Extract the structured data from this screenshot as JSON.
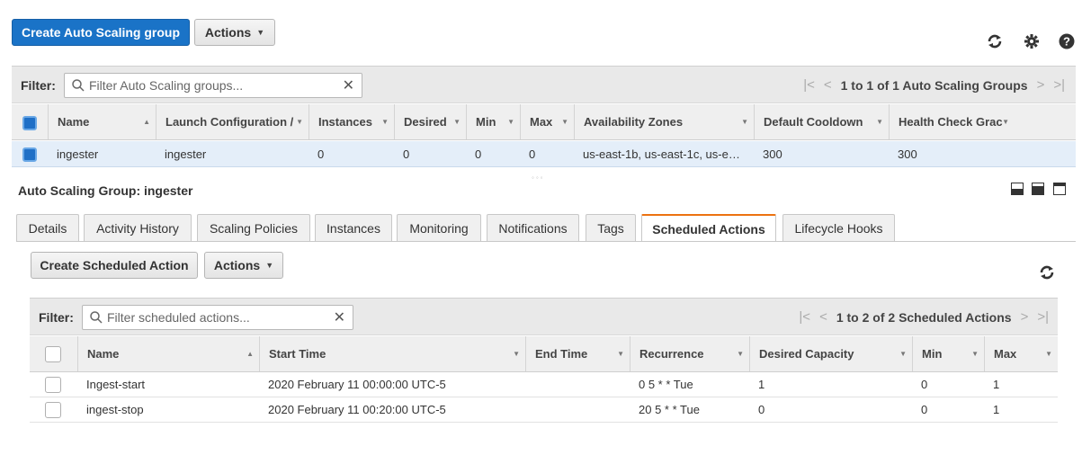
{
  "toolbar": {
    "create_label": "Create Auto Scaling group",
    "actions_label": "Actions"
  },
  "top_icons": [
    "refresh-icon",
    "gear-icon",
    "help-icon"
  ],
  "groups_grid": {
    "filter_label": "Filter:",
    "filter_placeholder": "Filter Auto Scaling groups...",
    "pager_text": "1 to 1 of 1 Auto Scaling Groups",
    "columns": [
      "Name",
      "Launch Configuration /",
      "Instances",
      "Desired",
      "Min",
      "Max",
      "Availability Zones",
      "Default Cooldown",
      "Health Check Grac"
    ],
    "rows": [
      {
        "name": "ingester",
        "launch_config": "ingester",
        "instances": "0",
        "desired": "0",
        "min": "0",
        "max": "0",
        "zones": "us-east-1b, us-east-1c, us-e…",
        "cooldown": "300",
        "health_check": "300"
      }
    ]
  },
  "detail": {
    "title": "Auto Scaling Group: ingester",
    "tabs": [
      "Details",
      "Activity History",
      "Scaling Policies",
      "Instances",
      "Monitoring",
      "Notifications",
      "Tags",
      "Scheduled Actions",
      "Lifecycle Hooks"
    ],
    "active_tab": "Scheduled Actions",
    "create_label": "Create Scheduled Action",
    "actions_label": "Actions"
  },
  "scheduled_grid": {
    "filter_label": "Filter:",
    "filter_placeholder": "Filter scheduled actions...",
    "pager_text": "1 to 2 of 2 Scheduled Actions",
    "columns": [
      "Name",
      "Start Time",
      "End Time",
      "Recurrence",
      "Desired Capacity",
      "Min",
      "Max"
    ],
    "rows": [
      {
        "name": "Ingest-start",
        "start": "2020 February 11 00:00:00 UTC-5",
        "end": "",
        "recurrence": "0 5 * * Tue",
        "desired": "1",
        "min": "0",
        "max": "1"
      },
      {
        "name": "ingest-stop",
        "start": "2020 February 11 00:20:00 UTC-5",
        "end": "",
        "recurrence": "20 5 * * Tue",
        "desired": "0",
        "min": "0",
        "max": "1"
      }
    ]
  },
  "colors": {
    "primary": "#1a73c7",
    "selected_row": "#e4eef9",
    "active_tab_accent": "#ec7211"
  }
}
